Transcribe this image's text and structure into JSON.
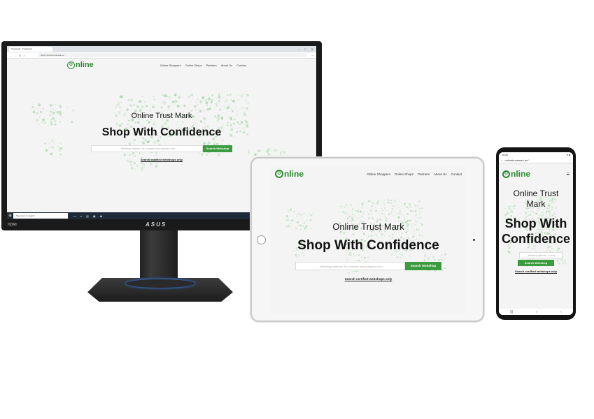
{
  "site": {
    "logo_text": "nline",
    "logo_letter": "O",
    "menu": [
      "Online Shoppers",
      "Online Shops",
      "Partners",
      "About Us",
      "Contact"
    ],
    "subtitle": "Online Trust Mark",
    "title": "Shop With Confidence",
    "title_line1": "Shop With",
    "title_line2": "Confidence",
    "subtitle_line1": "Online Trust",
    "subtitle_line2": "Mark",
    "search_placeholder": "Webshop address, for example www.ateppen.com",
    "search_placeholder_phone": "Webshop address, for exa",
    "search_button": "Search Webshop",
    "cert_link": "Search certified webshops only"
  },
  "monitor": {
    "brand": "ASUS",
    "hdmi": "HDMI",
    "tab_title": "Trustmark - Trustmark",
    "url": "https://onlinetrustmark.eu",
    "taskbar_search": "Type here to search"
  },
  "phone": {
    "time": "15:44",
    "url": "onlinetrustmark.eu/"
  },
  "colors": {
    "brand_green": "#2e8b32",
    "button_green": "#3c9a3f",
    "map_dots": "#7fc77f"
  }
}
